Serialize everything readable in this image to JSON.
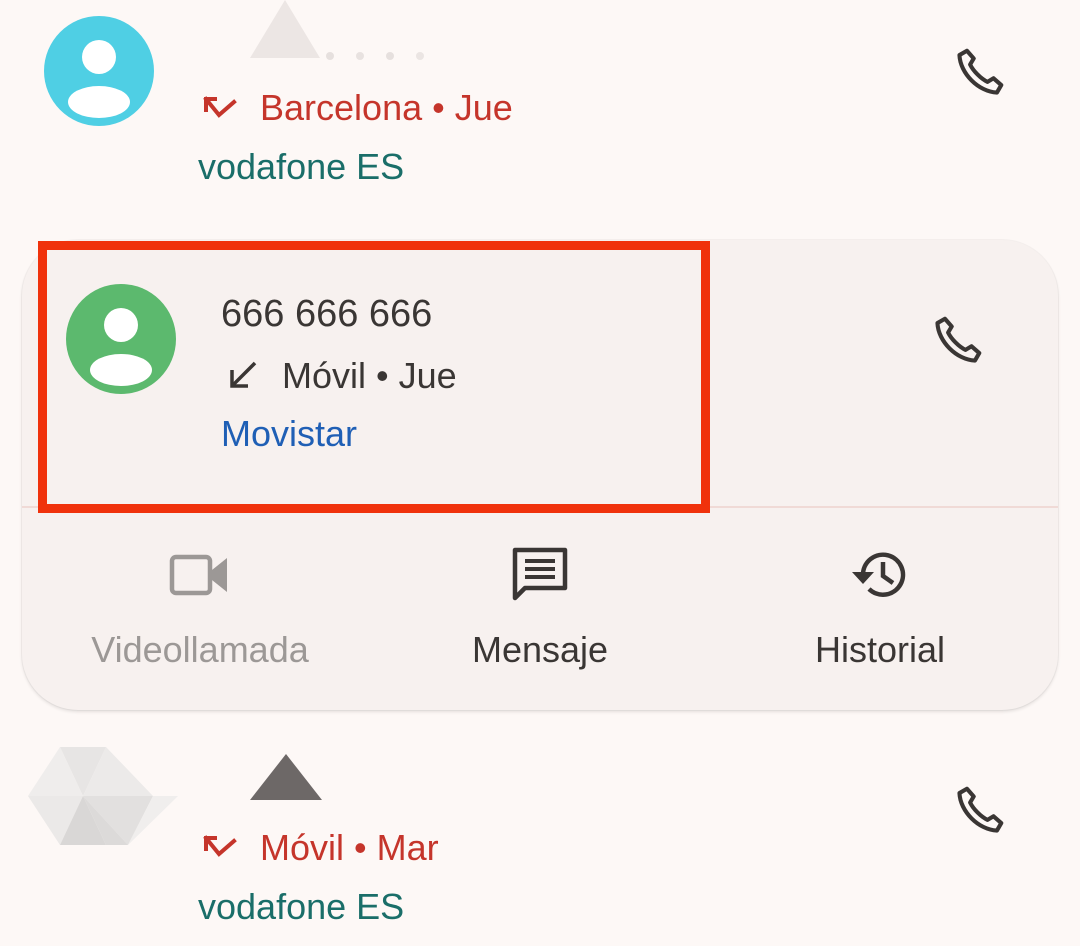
{
  "calls": [
    {
      "direction_icon": "missed-call-icon",
      "detail": "Barcelona • Jue",
      "carrier": "vodafone ES",
      "avatar_color": "#4fcfe4"
    },
    {
      "number": "666 666 666",
      "direction_icon": "incoming-call-icon",
      "detail": "Móvil • Jue",
      "carrier": "Movistar",
      "avatar_color": "#5cb96e",
      "expanded": true,
      "highlighted": true,
      "actions": [
        {
          "label": "Videollamada",
          "icon": "video-camera-icon",
          "enabled": false
        },
        {
          "label": "Mensaje",
          "icon": "message-icon",
          "enabled": true
        },
        {
          "label": "Historial",
          "icon": "history-icon",
          "enabled": true
        }
      ]
    },
    {
      "direction_icon": "missed-call-icon",
      "detail": "Móvil • Mar",
      "carrier": "vodafone ES"
    }
  ],
  "colors": {
    "missed": "#c5352b",
    "carrier_teal": "#1a6e69",
    "carrier_blue": "#1f5fb5",
    "highlight_border": "#f0320c",
    "card_bg": "#f7f1ef",
    "text_primary": "#3a3634",
    "text_disabled": "#9c9896"
  }
}
